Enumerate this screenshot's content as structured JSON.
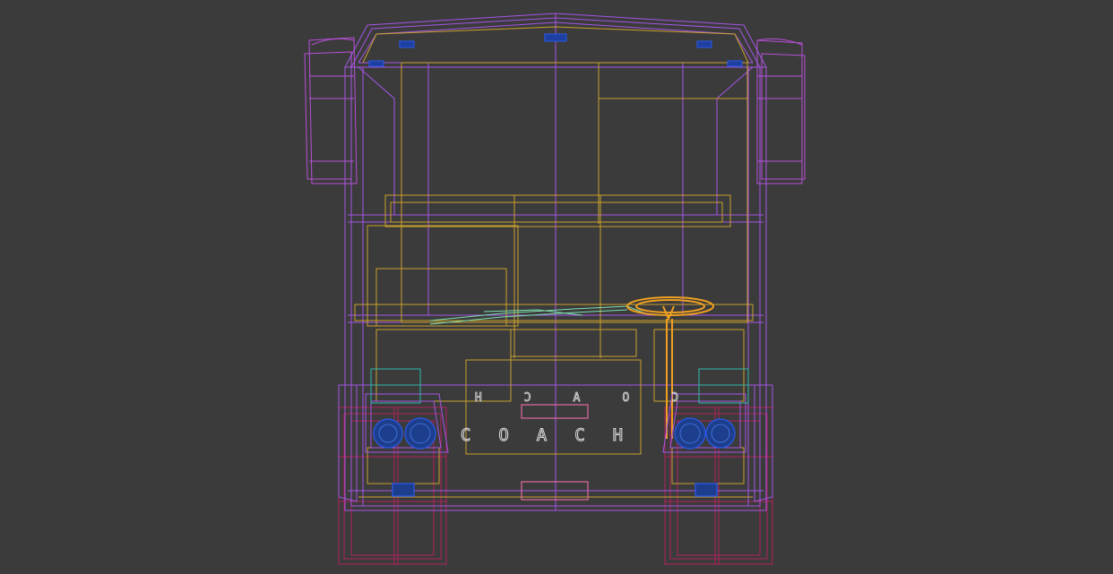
{
  "viewport": {
    "background": "#3b3b3b",
    "view": "front",
    "render_mode": "wireframe"
  },
  "model": {
    "type": "coach bus",
    "front_text": "COACH",
    "front_text_mirrored": "COACH"
  },
  "colors": {
    "body": "#a455e6",
    "interior": "#c9a22e",
    "mirrors": "#b84fd8",
    "wheels": "#b0225e",
    "headlights": "#2a55d8",
    "steering": "#f0a020",
    "dashboard": "#7de0b0",
    "grille": "#e06aa0",
    "teal_parts": "#2fb8a8"
  }
}
